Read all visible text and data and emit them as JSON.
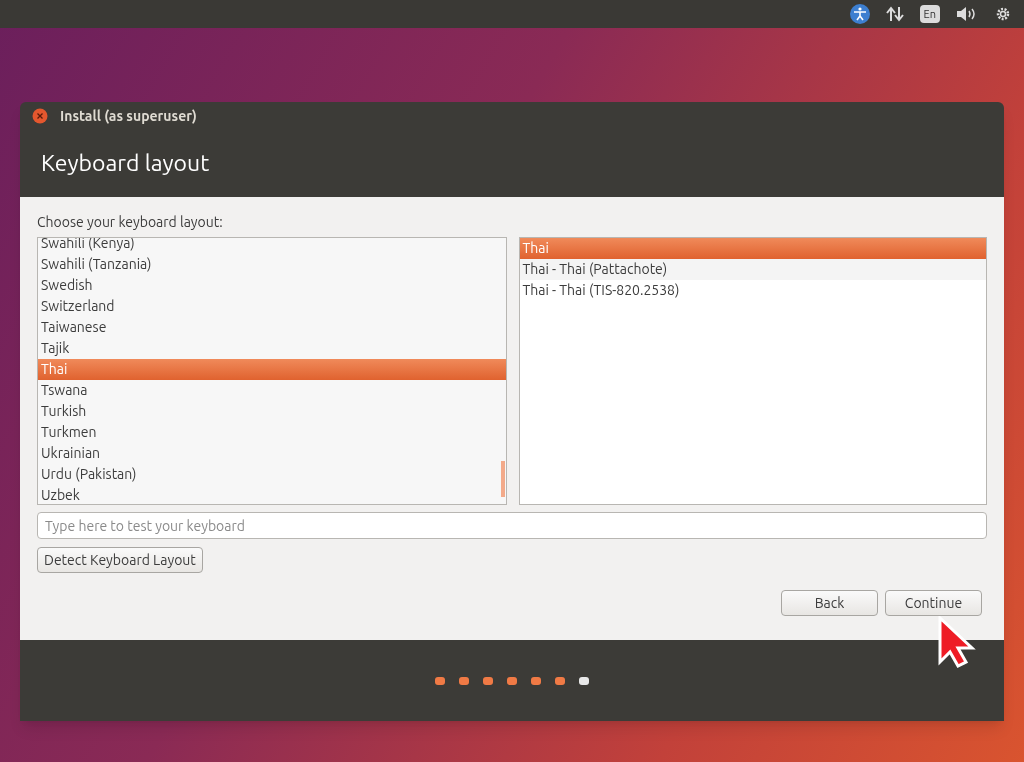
{
  "window": {
    "title": "Install (as superuser)"
  },
  "header": {
    "title": "Keyboard layout"
  },
  "prompt": "Choose your keyboard layout:",
  "layouts": [
    {
      "label": "Swahili (Kenya)",
      "selected": false
    },
    {
      "label": "Swahili (Tanzania)",
      "selected": false
    },
    {
      "label": "Swedish",
      "selected": false
    },
    {
      "label": "Switzerland",
      "selected": false
    },
    {
      "label": "Taiwanese",
      "selected": false
    },
    {
      "label": "Tajik",
      "selected": false
    },
    {
      "label": "Thai",
      "selected": true
    },
    {
      "label": "Tswana",
      "selected": false
    },
    {
      "label": "Turkish",
      "selected": false
    },
    {
      "label": "Turkmen",
      "selected": false
    },
    {
      "label": "Ukrainian",
      "selected": false
    },
    {
      "label": "Urdu (Pakistan)",
      "selected": false
    },
    {
      "label": "Uzbek",
      "selected": false
    }
  ],
  "variants": [
    {
      "label": "Thai",
      "selected": true
    },
    {
      "label": "Thai - Thai (Pattachote)",
      "selected": false
    },
    {
      "label": "Thai - Thai (TIS-820.2538)",
      "selected": false
    }
  ],
  "test_field": {
    "placeholder": "Type here to test your keyboard"
  },
  "detect_button": "Detect Keyboard Layout",
  "buttons": [
    "Back",
    "Continue"
  ],
  "steps": [
    {
      "done": true
    },
    {
      "done": true
    },
    {
      "done": true
    },
    {
      "done": true
    },
    {
      "done": true
    },
    {
      "done": true
    },
    {
      "done": false
    }
  ],
  "panel": {
    "language": "En"
  }
}
